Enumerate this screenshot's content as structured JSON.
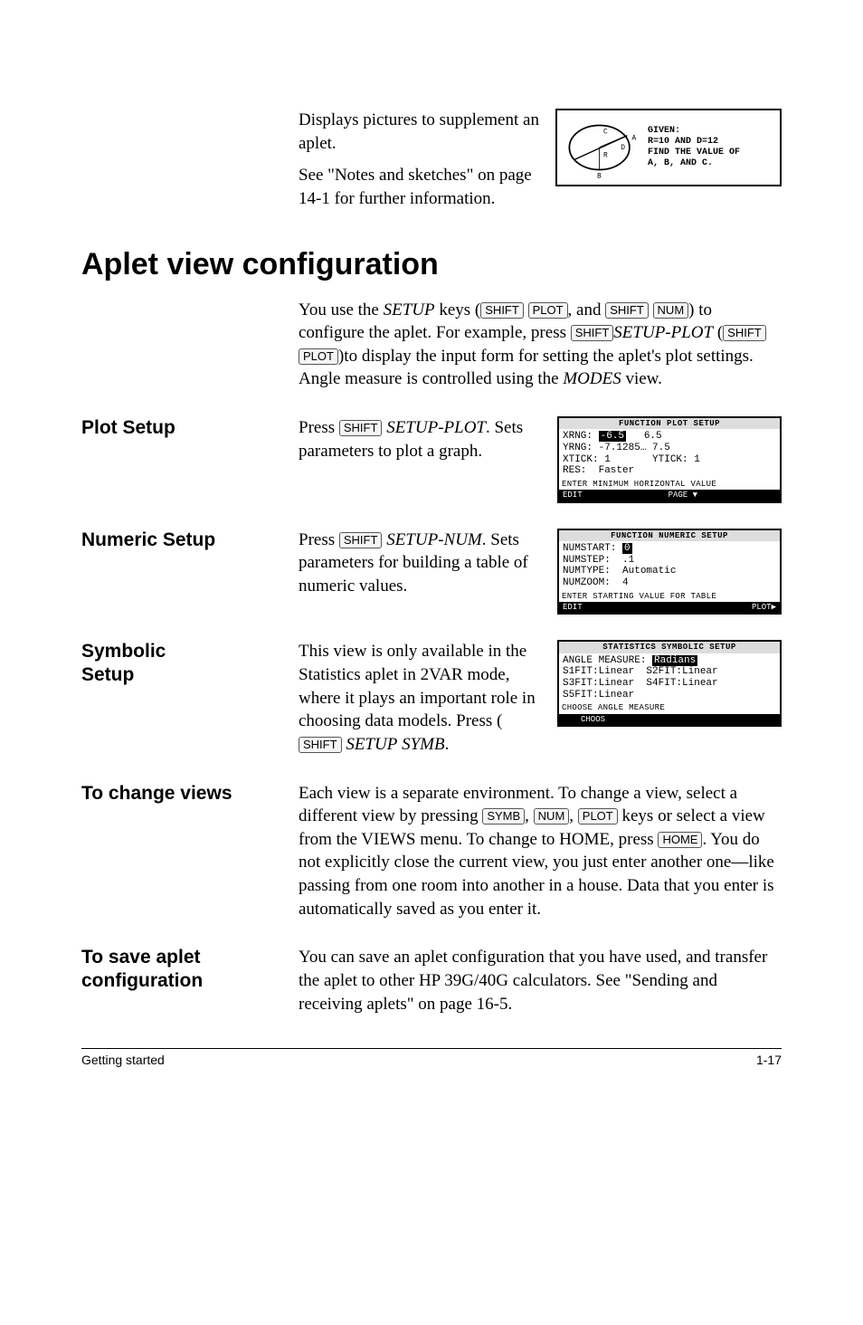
{
  "intro": {
    "p1": "Displays pictures to supplement an aplet.",
    "p2": "See \"Notes and sketches\" on page 14-1 for further information."
  },
  "sketch_screen": {
    "given": "GIVEN:",
    "l1": "R=10 AND D=12",
    "l2": "FIND THE VALUE OF",
    "l3": "A, B, AND C."
  },
  "h1": "Aplet view configuration",
  "config_intro": {
    "t1": "You use the ",
    "setup": "SETUP",
    "t2": " keys (",
    "k1": "SHIFT",
    "k2": "PLOT",
    "t3": ", and ",
    "k3": "SHIFT",
    "k4": "NUM",
    "t4": ") to configure the aplet. For example, press ",
    "k5": "SHIFT",
    "setup_plot": "SETUP-PLOT",
    "t5": " (",
    "k6": "SHIFT",
    "k7": "PLOT",
    "t6": ")to display the input form for setting the aplet's plot settings. Angle measure is controlled using the ",
    "modes": "MODES",
    "t7": " view."
  },
  "plot_setup": {
    "label": "Plot Setup",
    "t1": "Press ",
    "k1": "SHIFT",
    "sp": "SETUP-PLOT",
    "t2": ". Sets parameters to plot a graph.",
    "screen": {
      "hdr": "FUNCTION PLOT SETUP",
      "l1a": "XRNG: ",
      "l1b": "-6.5",
      "l1c": "   6.5",
      "l2": "YRNG: -7.1285… 7.5",
      "l3": "XTICK: 1       YTICK: 1",
      "l4": "RES:  Faster",
      "msg": "ENTER MINIMUM HORIZONTAL VALUE",
      "b1": "EDIT",
      "b2": "PAGE ▼"
    }
  },
  "numeric_setup": {
    "label": "Numeric Setup",
    "t1": "Press ",
    "k1": "SHIFT",
    "sp": "SETUP-NUM",
    "t2": ". Sets parameters for building a table of numeric values.",
    "screen": {
      "hdr": "FUNCTION NUMERIC SETUP",
      "l1a": "NUMSTART: ",
      "l1b": "0",
      "l2": "NUMSTEP:  .1",
      "l3": "NUMTYPE:  Automatic",
      "l4": "NUMZOOM:  4",
      "msg": "ENTER STARTING VALUE FOR TABLE",
      "b1": "EDIT",
      "b2": "PLOT▶"
    }
  },
  "symbolic_setup": {
    "label1": "Symbolic",
    "label2": "Setup",
    "t1": "This view is only available in the Statistics aplet in 2VAR mode, where it plays an important role in choosing data models. Press (",
    "k1": "SHIFT",
    "sp": "SETUP",
    "symb": "SYMB",
    "t2": ".",
    "screen": {
      "hdr": "STATISTICS SYMBOLIC SETUP",
      "l1a": "ANGLE MEASURE: ",
      "l1b": "Radians",
      "l2": "S1FIT:Linear  S2FIT:Linear",
      "l3": "S3FIT:Linear  S4FIT:Linear",
      "l4": "S5FIT:Linear",
      "msg": "CHOOSE ANGLE MEASURE",
      "b1": "CHOOS"
    }
  },
  "change_views": {
    "label": "To change views",
    "t1": "Each view is a separate environment. To change a view, select a different view by pressing ",
    "k1": "SYMB",
    "c1": ", ",
    "k2": "NUM",
    "c2": ", ",
    "k3": "PLOT",
    "t2": " keys or select a view from the VIEWS menu. To change to HOME, press ",
    "k4": "HOME",
    "t3": ". You do not explicitly close the current view, you just enter another one—like passing from one room into another in a house. Data that you enter is automatically saved as you enter it."
  },
  "save_aplet": {
    "label1": "To save aplet",
    "label2": "configuration",
    "t1": "You can save an aplet configuration that you have used, and transfer the aplet to other HP 39G/40G calculators. See \"Sending and receiving aplets\" on page 16-5."
  },
  "footer": {
    "left": "Getting started",
    "right": "1-17"
  }
}
